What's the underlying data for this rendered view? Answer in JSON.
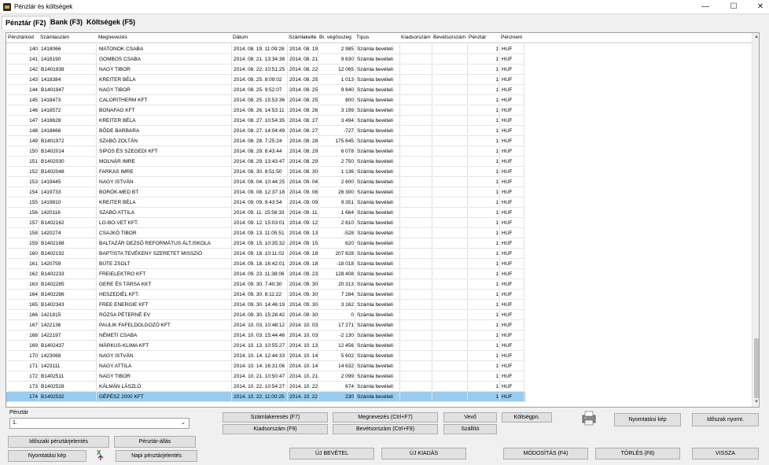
{
  "window": {
    "title": "Pénztár és költségek",
    "min": "—",
    "max": "☐",
    "close": "✕"
  },
  "tabs": [
    "Pénztár (F2)",
    "Bank (F3)",
    "Költségek (F5)"
  ],
  "columns": [
    "Pénztárkód",
    "Számlaszám",
    "Megnevezés",
    "Dátum",
    "Számlakelte",
    "Br. végösszeg",
    "Típus",
    "Kiadsorszám",
    "Bevétsorszám",
    "Pénztár",
    "Pénznem"
  ],
  "rows": [
    [
      "140",
      "1418066",
      "MATONOK CSABA",
      "2014. 08. 19. 11:09:28",
      "2014. 08. 19",
      "2 985",
      "Számla bevételi",
      "",
      "",
      "1",
      "HUF"
    ],
    [
      "141",
      "1418190",
      "GOMBOS CSABA",
      "2014. 08. 21. 13:34:38",
      "2014. 08. 21",
      "9 630",
      "Számla bevételi",
      "",
      "",
      "1",
      "HUF"
    ],
    [
      "142",
      "B1401938",
      "NAGY TIBOR",
      "2014. 08. 22. 10:51:25",
      "2014. 08. 22",
      "12 065",
      "Számla bevételi",
      "",
      "",
      "1",
      "HUF"
    ],
    [
      "143",
      "1418384",
      "KREITER BÉLA",
      "2014. 08. 25. 8:09:02",
      "2014. 08. 25",
      "1 013",
      "Számla bevételi",
      "",
      "",
      "1",
      "HUF"
    ],
    [
      "144",
      "B1401947",
      "NAGY TIBOR",
      "2014. 08. 25. 9:52:07",
      "2014. 08. 25",
      "9 840",
      "Számla bevételi",
      "",
      "",
      "1",
      "HUF"
    ],
    [
      "145",
      "1418473",
      "CALORITHERM KFT",
      "2014. 08. 25. 15:53:36",
      "2014. 08. 25",
      "800",
      "Számla bevételi",
      "",
      "",
      "1",
      "HUF"
    ],
    [
      "146",
      "1418572",
      "BONAFAG KFT",
      "2014. 08. 26. 14:53:11",
      "2014. 08. 26",
      "3 199",
      "Számla bevételi",
      "",
      "",
      "1",
      "HUF"
    ],
    [
      "147",
      "1418628",
      "KREITER BÉLA",
      "2014. 08. 27. 10:54:35",
      "2014. 08. 27",
      "3 494",
      "Számla bevételi",
      "",
      "",
      "1",
      "HUF"
    ],
    [
      "148",
      "1418666",
      "BŐDE BARBARA",
      "2014. 08. 27. 14:04:49",
      "2014. 08. 27",
      "-727",
      "Számla bevételi",
      "",
      "",
      "1",
      "HUF"
    ],
    [
      "149",
      "B1401972",
      "SZABÓ ZOLTÁN",
      "2014. 08. 28. 7:25:24",
      "2014. 08. 28",
      "175 645",
      "Számla bevételi",
      "",
      "",
      "1",
      "HUF"
    ],
    [
      "150",
      "B1402014",
      "SIPOS ÉS SZEGEDI KFT",
      "2014. 08. 29. 8:43:44",
      "2014. 08. 29",
      "6 078",
      "Számla bevételi",
      "",
      "",
      "1",
      "HUF"
    ],
    [
      "151",
      "B1402030",
      "MOLNÁR IMRE",
      "2014. 08. 29. 13:43:47",
      "2014. 08. 29",
      "2 750",
      "Számla bevételi",
      "",
      "",
      "1",
      "HUF"
    ],
    [
      "152",
      "B1402048",
      "FARKAS IMRE",
      "2014. 08. 30. 8:51:50",
      "2014. 08. 30",
      "1 136",
      "Számla bevételi",
      "",
      "",
      "1",
      "HUF"
    ],
    [
      "153",
      "1419445",
      "NAGY ISTVÁN",
      "2014. 09. 04. 10:44:25",
      "2014. 09. 04",
      "2 600",
      "Számla bevételi",
      "",
      "",
      "1",
      "HUF"
    ],
    [
      "154",
      "1419733",
      "BORÓK-MED BT",
      "2014. 09. 08. 12:37:18",
      "2014. 09. 08",
      "26 300",
      "Számla bevételi",
      "",
      "",
      "1",
      "HUF"
    ],
    [
      "155",
      "1419810",
      "KREITER BÉLA",
      "2014. 09. 09. 9:43:54",
      "2014. 09. 09",
      "9 351",
      "Számla bevételi",
      "",
      "",
      "1",
      "HUF"
    ],
    [
      "156",
      "1420116",
      "SZABÓ ATTILA",
      "2014. 09. 11. 15:56:33",
      "2014. 09. 11",
      "1 664",
      "Számla bevételi",
      "",
      "",
      "1",
      "HUF"
    ],
    [
      "157",
      "B1402162",
      "LO-BO-VET KFT.",
      "2014. 09. 12. 15:03:01",
      "2014. 09. 12",
      "2 610",
      "Számla bevételi",
      "",
      "",
      "1",
      "HUF"
    ],
    [
      "158",
      "1420274",
      "CSAJKÓ TIBOR",
      "2014. 09. 13. 11:05:51",
      "2014. 09. 13",
      "-528",
      "Számla bevételi",
      "",
      "",
      "1",
      "HUF"
    ],
    [
      "159",
      "B1402168",
      "BALTAZÁR DEZSŐ REFORMÁTUS ÁLT.ISKOLA",
      "2014. 09. 15. 10:35:32",
      "2014. 09. 15",
      "620",
      "Számla bevételi",
      "",
      "",
      "1",
      "HUF"
    ],
    [
      "160",
      "B1402192",
      "BAPTISTA TEVÉKENY SZERETET MISSZIÓ",
      "2014. 09. 18. 10:11:02",
      "2014. 09. 18",
      "207 828",
      "Számla bevételi",
      "",
      "",
      "1",
      "HUF"
    ],
    [
      "161",
      "1420759",
      "BÜTE ZSOLT",
      "2014. 09. 18. 16:42:01",
      "2014. 09. 18",
      "-18 018",
      "Számla bevételi",
      "",
      "",
      "1",
      "HUF"
    ],
    [
      "162",
      "B1402233",
      "FREIELEKTRO KFT",
      "2014. 09. 23. 11:38:06",
      "2014. 09. 23",
      "128 408",
      "Számla bevételi",
      "",
      "",
      "1",
      "HUF"
    ],
    [
      "163",
      "B1402285",
      "GERE ÉS TÁRSA KKT",
      "2014. 09. 30. 7:40:30",
      "2014. 09. 30",
      "20 313",
      "Számla bevételi",
      "",
      "",
      "1",
      "HUF"
    ],
    [
      "164",
      "B1402286",
      "HESZEDIÉL KFT.",
      "2014. 09. 30. 8:11:22",
      "2014. 09. 30",
      "7 284",
      "Számla bevételi",
      "",
      "",
      "1",
      "HUF"
    ],
    [
      "165",
      "B1402343",
      "FREE ENERGIE KFT",
      "2014. 09. 30. 14:46:19",
      "2014. 09. 30",
      "3 162",
      "Számla bevételi",
      "",
      "",
      "1",
      "HUF"
    ],
    [
      "166",
      "1421815",
      "RÓZSA PÉTERNÉ EV",
      "2014. 09. 30. 15:28:42",
      "2014. 09. 30",
      "0",
      "Számla bevételi",
      "",
      "",
      "1",
      "HUF"
    ],
    [
      "167",
      "1422136",
      "PAULIK FAFELDOLGOZÓ KFT",
      "2014. 10. 03. 10:48:12",
      "2014. 10. 03",
      "17 271",
      "Számla bevételi",
      "",
      "",
      "1",
      "HUF"
    ],
    [
      "168",
      "1422197",
      "NÉMETI CSABA",
      "2014. 10. 03. 15:44:46",
      "2014. 10. 03",
      "-2 130",
      "Számla bevételi",
      "",
      "",
      "1",
      "HUF"
    ],
    [
      "169",
      "B1402437",
      "MÁRKUS-KLIMA KFT",
      "2014. 10. 13. 10:55:27",
      "2014. 10. 13",
      "12 456",
      "Számla bevételi",
      "",
      "",
      "1",
      "HUF"
    ],
    [
      "170",
      "1423068",
      "NAGY ISTVÁN",
      "2014. 10. 14. 12:44:33",
      "2014. 10. 14",
      "5 602",
      "Számla bevételi",
      "",
      "",
      "1",
      "HUF"
    ],
    [
      "171",
      "1423111",
      "NAGY ATTILA",
      "2014. 10. 14. 16:31:06",
      "2014. 10. 14",
      "14 632",
      "Számla bevételi",
      "",
      "",
      "1",
      "HUF"
    ],
    [
      "172",
      "B1402511",
      "NAGY TIBOR",
      "2014. 10. 21. 10:50:47",
      "2014. 10. 21",
      "2 099",
      "Számla bevételi",
      "",
      "",
      "1",
      "HUF"
    ],
    [
      "173",
      "B1402528",
      "KÁLMÁN LÁSZLÓ",
      "2014. 10. 22. 10:54:27",
      "2014. 10. 22",
      "674",
      "Számla bevételi",
      "",
      "",
      "1",
      "HUF"
    ],
    [
      "174",
      "B1402532",
      "GÉPÉSZ 2000 KFT",
      "2014. 10. 22. 11:00:25",
      "2014. 10. 22",
      "230",
      "Számla bevételi",
      "",
      "",
      "1",
      "HUF"
    ]
  ],
  "selected_row_index": 34,
  "penztar": {
    "label": "Pénztár",
    "value": "1."
  },
  "buttons": {
    "szamlakereses": "Számlakeresés (F7)",
    "megnevezes": "Megnevezés (Ctrl+F7)",
    "vevo": "Vevő",
    "koltsegpn": "Költségpn.",
    "nyomtatasi_kep_top": "Nyomtatási kép",
    "idoszak_nyomt": "Időszak nyomt.",
    "kiadsorszam": "Kiadsorszám (F9)",
    "bevetsorszam": "Bevétsorszám (Ctrl+F9)",
    "szallito": "Szállító",
    "idoszaki_jelentes": "Időszaki pénztárjelentés",
    "penztar_allas": "Pénztár-állás",
    "nyomtatasi_kep_bottom": "Nyomtatási kép",
    "napi_jelentes": "Napi pénztárjelentés",
    "uj_bevetel": "ÚJ BEVÉTEL",
    "uj_kiadas": "ÚJ KIADÁS",
    "modositas": "MÓDOSÍTÁS (F4)",
    "torles": "TÖRLÉS (F8)",
    "vissza": "VISSZA"
  },
  "colors": {
    "selected_row": "#99ccee",
    "window_bg": "#f0f0f0"
  }
}
